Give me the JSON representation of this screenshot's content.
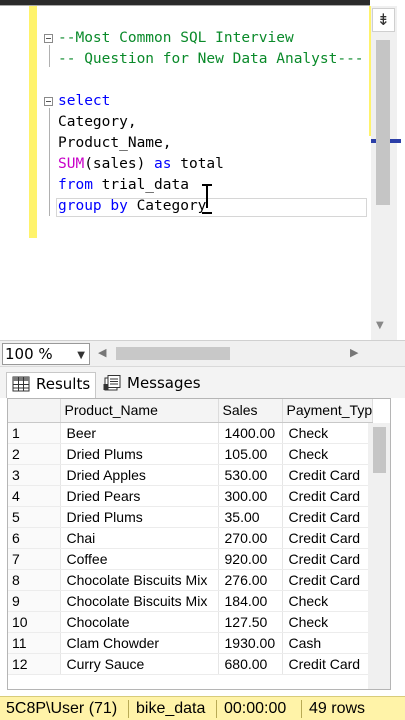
{
  "editor": {
    "lines": [
      {
        "parts": [
          {
            "t": "--Most Common SQL Interview",
            "c": "cm"
          }
        ]
      },
      {
        "parts": [
          {
            "t": "-- Question for New Data Analyst---",
            "c": "cm"
          }
        ]
      },
      {
        "parts": [
          {
            "t": "select",
            "c": "kw"
          }
        ]
      },
      {
        "parts": [
          {
            "t": "Category,",
            "c": ""
          }
        ]
      },
      {
        "parts": [
          {
            "t": "Product_Name,",
            "c": ""
          }
        ]
      },
      {
        "parts": [
          {
            "t": "SUM",
            "c": "fn"
          },
          {
            "t": "(sales) ",
            "c": ""
          },
          {
            "t": "as",
            "c": "kw"
          },
          {
            "t": " total",
            "c": ""
          }
        ]
      },
      {
        "parts": [
          {
            "t": "from",
            "c": "kw"
          },
          {
            "t": " trial_data",
            "c": ""
          }
        ]
      },
      {
        "parts": [
          {
            "t": "group by",
            "c": "kw"
          },
          {
            "t": " Category",
            "c": ""
          }
        ]
      }
    ]
  },
  "toolbar": {
    "zoom": "100 %",
    "split_icon": "split-icon"
  },
  "results": {
    "tabs": [
      {
        "label": "Results",
        "icon": "grid-icon",
        "active": true
      },
      {
        "label": "Messages",
        "icon": "messages-icon",
        "active": false
      }
    ],
    "columns": [
      "",
      "Product_Name",
      "Sales",
      "Payment_Typ"
    ],
    "rows": [
      [
        "1",
        "Beer",
        "1400.00",
        "Check"
      ],
      [
        "2",
        "Dried Plums",
        "105.00",
        "Check"
      ],
      [
        "3",
        "Dried Apples",
        "530.00",
        "Credit Card"
      ],
      [
        "4",
        "Dried Pears",
        "300.00",
        "Credit Card"
      ],
      [
        "5",
        "Dried Plums",
        "35.00",
        "Credit Card"
      ],
      [
        "6",
        "Chai",
        "270.00",
        "Credit Card"
      ],
      [
        "7",
        "Coffee",
        "920.00",
        "Credit Card"
      ],
      [
        "8",
        "Chocolate Biscuits Mix",
        "276.00",
        "Credit Card"
      ],
      [
        "9",
        "Chocolate Biscuits Mix",
        "184.00",
        "Check"
      ],
      [
        "10",
        "Chocolate",
        "127.50",
        "Check"
      ],
      [
        "11",
        "Clam Chowder",
        "1930.00",
        "Cash"
      ],
      [
        "12",
        "Curry Sauce",
        "680.00",
        "Credit Card"
      ]
    ]
  },
  "status": {
    "user": "5C8P\\User (71)",
    "database": "bike_data",
    "elapsed": "00:00:00",
    "rows": "49 rows"
  },
  "colors": {
    "comment": "#0a8a2a",
    "keyword": "#0000ff",
    "function": "#c800c8",
    "status_bg": "#fff3a8",
    "change_marker": "#fff36b"
  }
}
